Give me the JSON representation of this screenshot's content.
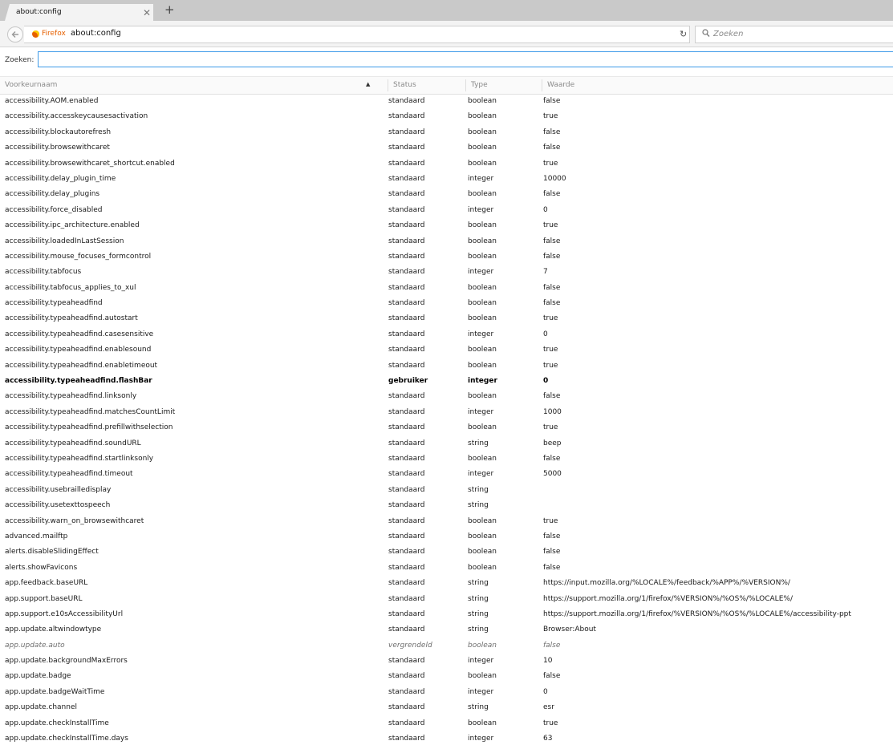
{
  "tab": {
    "title": "about:config"
  },
  "navbar": {
    "identity_label": "Firefox",
    "url": "about:config",
    "search_placeholder": "Zoeken"
  },
  "filter": {
    "label": "Zoeken:",
    "value": ""
  },
  "columns": {
    "name": "Voorkeurnaam",
    "status": "Status",
    "type": "Type",
    "value": "Waarde"
  },
  "rows": [
    {
      "name": "accessibility.AOM.enabled",
      "status": "standaard",
      "type": "boolean",
      "value": "false"
    },
    {
      "name": "accessibility.accesskeycausesactivation",
      "status": "standaard",
      "type": "boolean",
      "value": "true"
    },
    {
      "name": "accessibility.blockautorefresh",
      "status": "standaard",
      "type": "boolean",
      "value": "false"
    },
    {
      "name": "accessibility.browsewithcaret",
      "status": "standaard",
      "type": "boolean",
      "value": "false"
    },
    {
      "name": "accessibility.browsewithcaret_shortcut.enabled",
      "status": "standaard",
      "type": "boolean",
      "value": "true"
    },
    {
      "name": "accessibility.delay_plugin_time",
      "status": "standaard",
      "type": "integer",
      "value": "10000"
    },
    {
      "name": "accessibility.delay_plugins",
      "status": "standaard",
      "type": "boolean",
      "value": "false"
    },
    {
      "name": "accessibility.force_disabled",
      "status": "standaard",
      "type": "integer",
      "value": "0"
    },
    {
      "name": "accessibility.ipc_architecture.enabled",
      "status": "standaard",
      "type": "boolean",
      "value": "true"
    },
    {
      "name": "accessibility.loadedInLastSession",
      "status": "standaard",
      "type": "boolean",
      "value": "false"
    },
    {
      "name": "accessibility.mouse_focuses_formcontrol",
      "status": "standaard",
      "type": "boolean",
      "value": "false"
    },
    {
      "name": "accessibility.tabfocus",
      "status": "standaard",
      "type": "integer",
      "value": "7"
    },
    {
      "name": "accessibility.tabfocus_applies_to_xul",
      "status": "standaard",
      "type": "boolean",
      "value": "false"
    },
    {
      "name": "accessibility.typeaheadfind",
      "status": "standaard",
      "type": "boolean",
      "value": "false"
    },
    {
      "name": "accessibility.typeaheadfind.autostart",
      "status": "standaard",
      "type": "boolean",
      "value": "true"
    },
    {
      "name": "accessibility.typeaheadfind.casesensitive",
      "status": "standaard",
      "type": "integer",
      "value": "0"
    },
    {
      "name": "accessibility.typeaheadfind.enablesound",
      "status": "standaard",
      "type": "boolean",
      "value": "true"
    },
    {
      "name": "accessibility.typeaheadfind.enabletimeout",
      "status": "standaard",
      "type": "boolean",
      "value": "true"
    },
    {
      "name": "accessibility.typeaheadfind.flashBar",
      "status": "gebruiker",
      "type": "integer",
      "value": "0"
    },
    {
      "name": "accessibility.typeaheadfind.linksonly",
      "status": "standaard",
      "type": "boolean",
      "value": "false"
    },
    {
      "name": "accessibility.typeaheadfind.matchesCountLimit",
      "status": "standaard",
      "type": "integer",
      "value": "1000"
    },
    {
      "name": "accessibility.typeaheadfind.prefillwithselection",
      "status": "standaard",
      "type": "boolean",
      "value": "true"
    },
    {
      "name": "accessibility.typeaheadfind.soundURL",
      "status": "standaard",
      "type": "string",
      "value": "beep"
    },
    {
      "name": "accessibility.typeaheadfind.startlinksonly",
      "status": "standaard",
      "type": "boolean",
      "value": "false"
    },
    {
      "name": "accessibility.typeaheadfind.timeout",
      "status": "standaard",
      "type": "integer",
      "value": "5000"
    },
    {
      "name": "accessibility.usebrailledisplay",
      "status": "standaard",
      "type": "string",
      "value": ""
    },
    {
      "name": "accessibility.usetexttospeech",
      "status": "standaard",
      "type": "string",
      "value": ""
    },
    {
      "name": "accessibility.warn_on_browsewithcaret",
      "status": "standaard",
      "type": "boolean",
      "value": "true"
    },
    {
      "name": "advanced.mailftp",
      "status": "standaard",
      "type": "boolean",
      "value": "false"
    },
    {
      "name": "alerts.disableSlidingEffect",
      "status": "standaard",
      "type": "boolean",
      "value": "false"
    },
    {
      "name": "alerts.showFavicons",
      "status": "standaard",
      "type": "boolean",
      "value": "false"
    },
    {
      "name": "app.feedback.baseURL",
      "status": "standaard",
      "type": "string",
      "value": "https://input.mozilla.org/%LOCALE%/feedback/%APP%/%VERSION%/"
    },
    {
      "name": "app.support.baseURL",
      "status": "standaard",
      "type": "string",
      "value": "https://support.mozilla.org/1/firefox/%VERSION%/%OS%/%LOCALE%/"
    },
    {
      "name": "app.support.e10sAccessibilityUrl",
      "status": "standaard",
      "type": "string",
      "value": "https://support.mozilla.org/1/firefox/%VERSION%/%OS%/%LOCALE%/accessibility-ppt"
    },
    {
      "name": "app.update.altwindowtype",
      "status": "standaard",
      "type": "string",
      "value": "Browser:About"
    },
    {
      "name": "app.update.auto",
      "status": "vergrendeld",
      "type": "boolean",
      "value": "false"
    },
    {
      "name": "app.update.backgroundMaxErrors",
      "status": "standaard",
      "type": "integer",
      "value": "10"
    },
    {
      "name": "app.update.badge",
      "status": "standaard",
      "type": "boolean",
      "value": "false"
    },
    {
      "name": "app.update.badgeWaitTime",
      "status": "standaard",
      "type": "integer",
      "value": "0"
    },
    {
      "name": "app.update.channel",
      "status": "standaard",
      "type": "string",
      "value": "esr"
    },
    {
      "name": "app.update.checkInstallTime",
      "status": "standaard",
      "type": "boolean",
      "value": "true"
    },
    {
      "name": "app.update.checkInstallTime.days",
      "status": "standaard",
      "type": "integer",
      "value": "63"
    }
  ]
}
